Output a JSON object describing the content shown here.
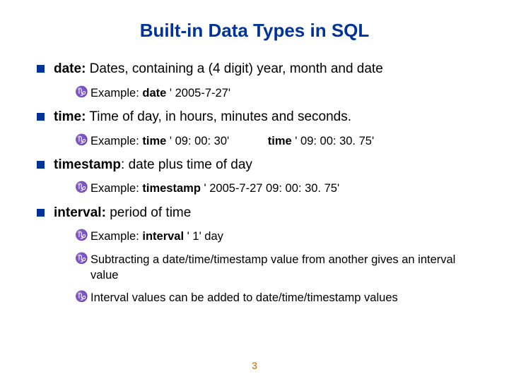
{
  "title": "Built-in Data Types in SQL",
  "items": [
    {
      "kw": "date:",
      "rest": "  Dates, containing a (4 digit) year, month and date",
      "subs": [
        {
          "pre": "Example:  ",
          "kw": "date",
          "post": " ' 2005-7-27'"
        }
      ]
    },
    {
      "kw": "time:",
      "rest": "  Time of day, in hours, minutes and seconds.",
      "subs": [
        {
          "pre": "Example:  ",
          "kw": "time",
          "post": " ' 09: 00: 30'",
          "extra_kw": "time",
          "extra_post": " ' 09: 00: 30. 75'"
        }
      ]
    },
    {
      "kw": "timestamp",
      "rest": ": date plus time of day",
      "subs": [
        {
          "pre": "Example:  ",
          "kw": "timestamp ",
          "post": " ' 2005-7-27 09: 00: 30. 75'"
        }
      ]
    },
    {
      "kw": "interval:",
      "rest": "  period of time",
      "subs": [
        {
          "pre": "Example:   ",
          "kw": "interval ",
          "post": " ' 1' day"
        },
        {
          "pre": "Subtracting a date/time/timestamp value from another gives an interval value",
          "kw": "",
          "post": ""
        },
        {
          "pre": "Interval values can be added to date/time/timestamp values",
          "kw": "",
          "post": ""
        }
      ]
    }
  ],
  "page_number": "3"
}
